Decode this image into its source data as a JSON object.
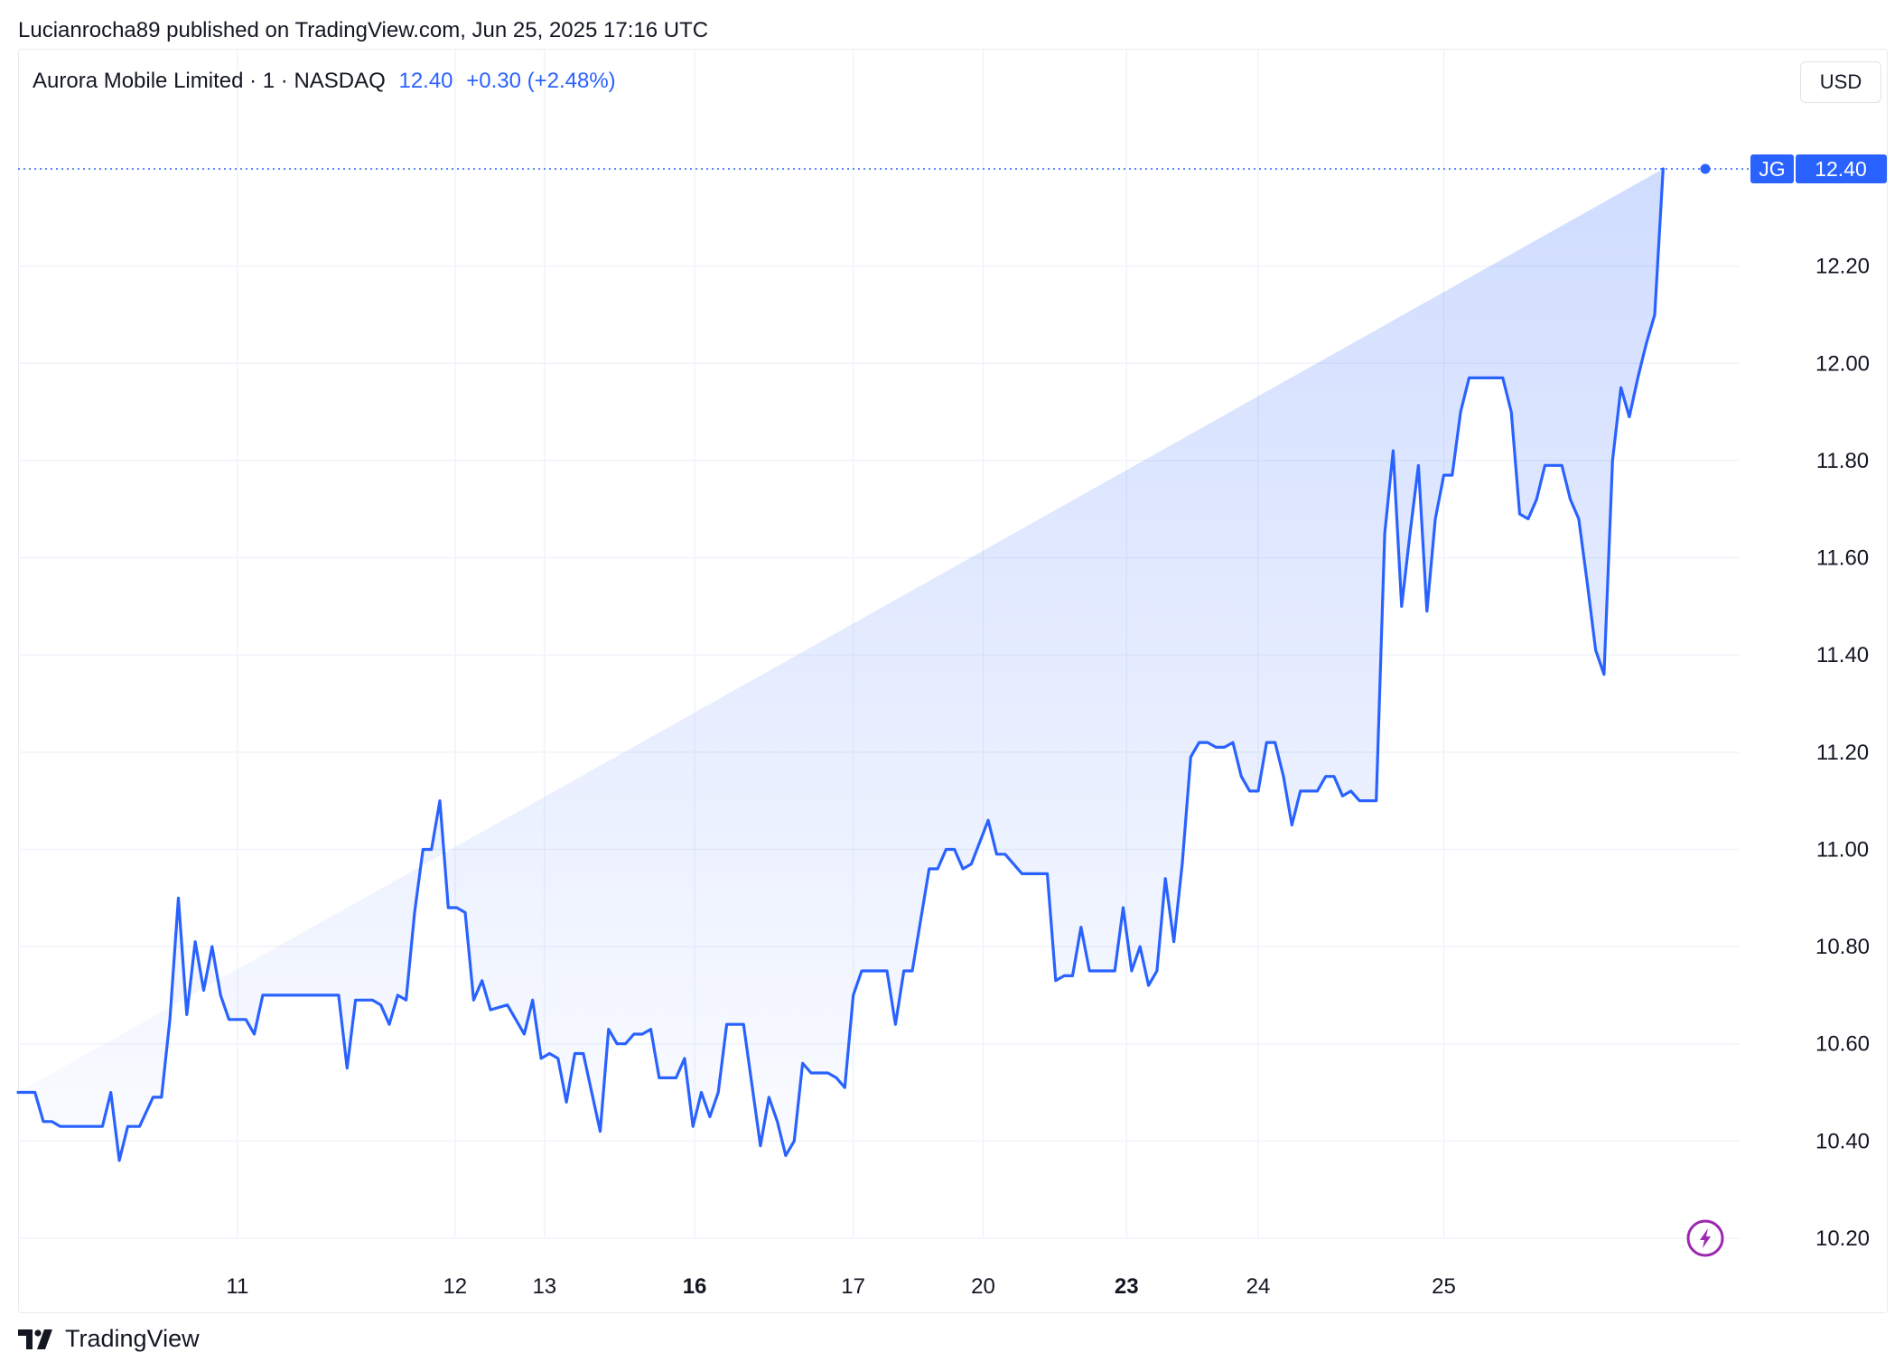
{
  "header": {
    "published_by": "Lucianrocha89 published on TradingView.com, Jun 25, 2025 17:16 UTC"
  },
  "legend": {
    "symbol": "Aurora Mobile Limited · 1 · NASDAQ",
    "price": "12.40",
    "change": "+0.30 (+2.48%)"
  },
  "currency_label": "USD",
  "last_price_tag": {
    "ticker": "JG",
    "price": "12.40"
  },
  "footer": {
    "brand": "TradingView",
    "logo_icon": "tradingview-logo-icon"
  },
  "snapshot_icon": "lightning-icon",
  "colors": {
    "line": "#2962ff",
    "grid": "#f0f3fa",
    "text": "#131722",
    "snapshot": "#9c27b0"
  },
  "chart_data": {
    "type": "area",
    "ylim": [
      10.2,
      12.4
    ],
    "x_range": [
      0,
      1000
    ],
    "yticks": [
      "10.20",
      "10.40",
      "10.60",
      "10.80",
      "11.00",
      "11.20",
      "11.40",
      "11.60",
      "11.80",
      "12.00",
      "12.20"
    ],
    "xticks": [
      {
        "label": "11",
        "x": 130,
        "bold": false
      },
      {
        "label": "12",
        "x": 259,
        "bold": false
      },
      {
        "label": "13",
        "x": 312,
        "bold": false
      },
      {
        "label": "16",
        "x": 401,
        "bold": true
      },
      {
        "label": "17",
        "x": 495,
        "bold": false
      },
      {
        "label": "20",
        "x": 572,
        "bold": false
      },
      {
        "label": "23",
        "x": 657,
        "bold": true
      },
      {
        "label": "24",
        "x": 735,
        "bold": false
      },
      {
        "label": "25",
        "x": 845,
        "bold": false
      }
    ],
    "x": [
      0,
      10,
      15,
      20,
      25,
      35,
      50,
      55,
      60,
      65,
      72,
      80,
      85,
      90,
      95,
      100,
      105,
      110,
      115,
      120,
      125,
      135,
      140,
      145,
      155,
      162,
      170,
      180,
      190,
      195,
      200,
      210,
      215,
      220,
      225,
      230,
      235,
      240,
      245,
      250,
      255,
      260,
      265,
      270,
      275,
      280,
      290,
      295,
      300,
      305,
      310,
      315,
      320,
      325,
      330,
      335,
      340,
      345,
      350,
      355,
      360,
      365,
      370,
      375,
      380,
      385,
      390,
      395,
      400,
      405,
      410,
      415,
      420,
      425,
      430,
      440,
      445,
      450,
      455,
      460,
      465,
      470,
      475,
      480,
      485,
      490,
      495,
      500,
      505,
      510,
      515,
      520,
      525,
      530,
      540,
      545,
      550,
      555,
      560,
      565,
      575,
      580,
      585,
      590,
      595,
      600,
      605,
      610,
      615,
      620,
      625,
      630,
      635,
      640,
      645,
      650,
      655,
      660,
      665,
      670,
      675,
      680,
      685,
      690,
      695,
      700,
      705,
      710,
      715,
      720,
      725,
      730,
      735,
      740,
      745,
      750,
      755,
      760,
      765,
      770,
      775,
      780,
      785,
      790,
      795,
      800,
      805,
      810,
      815,
      820,
      825,
      830,
      835,
      840,
      845,
      850,
      855,
      860,
      865,
      870,
      875,
      880,
      885,
      890,
      895,
      900,
      905,
      910,
      915,
      920,
      925,
      930,
      935,
      940,
      945,
      950,
      955,
      960,
      965,
      970,
      975,
      980,
      985,
      990,
      995,
      1000
    ],
    "values": [
      10.5,
      10.5,
      10.44,
      10.44,
      10.43,
      10.43,
      10.43,
      10.5,
      10.36,
      10.43,
      10.43,
      10.49,
      10.49,
      10.65,
      10.9,
      10.66,
      10.81,
      10.71,
      10.8,
      10.7,
      10.65,
      10.65,
      10.62,
      10.7,
      10.7,
      10.7,
      10.7,
      10.7,
      10.7,
      10.55,
      10.69,
      10.69,
      10.68,
      10.64,
      10.7,
      10.69,
      10.87,
      11.0,
      11.0,
      11.1,
      10.88,
      10.88,
      10.87,
      10.69,
      10.73,
      10.67,
      10.68,
      10.65,
      10.62,
      10.69,
      10.57,
      10.58,
      10.57,
      10.48,
      10.58,
      10.58,
      10.5,
      10.42,
      10.63,
      10.6,
      10.6,
      10.62,
      10.62,
      10.63,
      10.53,
      10.53,
      10.53,
      10.57,
      10.43,
      10.5,
      10.45,
      10.5,
      10.64,
      10.64,
      10.64,
      10.39,
      10.49,
      10.44,
      10.37,
      10.4,
      10.56,
      10.54,
      10.54,
      10.54,
      10.53,
      10.51,
      10.7,
      10.75,
      10.75,
      10.75,
      10.75,
      10.64,
      10.75,
      10.75,
      10.96,
      10.96,
      11.0,
      11.0,
      10.96,
      10.97,
      11.06,
      10.99,
      10.99,
      10.97,
      10.95,
      10.95,
      10.95,
      10.95,
      10.73,
      10.74,
      10.74,
      10.84,
      10.75,
      10.75,
      10.75,
      10.75,
      10.88,
      10.75,
      10.8,
      10.72,
      10.75,
      10.94,
      10.81,
      10.97,
      11.19,
      11.22,
      11.22,
      11.21,
      11.21,
      11.22,
      11.15,
      11.12,
      11.12,
      11.22,
      11.22,
      11.15,
      11.05,
      11.12,
      11.12,
      11.12,
      11.15,
      11.15,
      11.11,
      11.12,
      11.1,
      11.1,
      11.1,
      11.65,
      11.82,
      11.5,
      11.65,
      11.79,
      11.49,
      11.68,
      11.77,
      11.77,
      11.9,
      11.97,
      11.97,
      11.97,
      11.97,
      11.97,
      11.9,
      11.69,
      11.68,
      11.72,
      11.79,
      11.79,
      11.79,
      11.72,
      11.68,
      11.55,
      11.41,
      11.36,
      11.8,
      11.95,
      11.89,
      11.97,
      12.04,
      12.1,
      12.4
    ]
  }
}
